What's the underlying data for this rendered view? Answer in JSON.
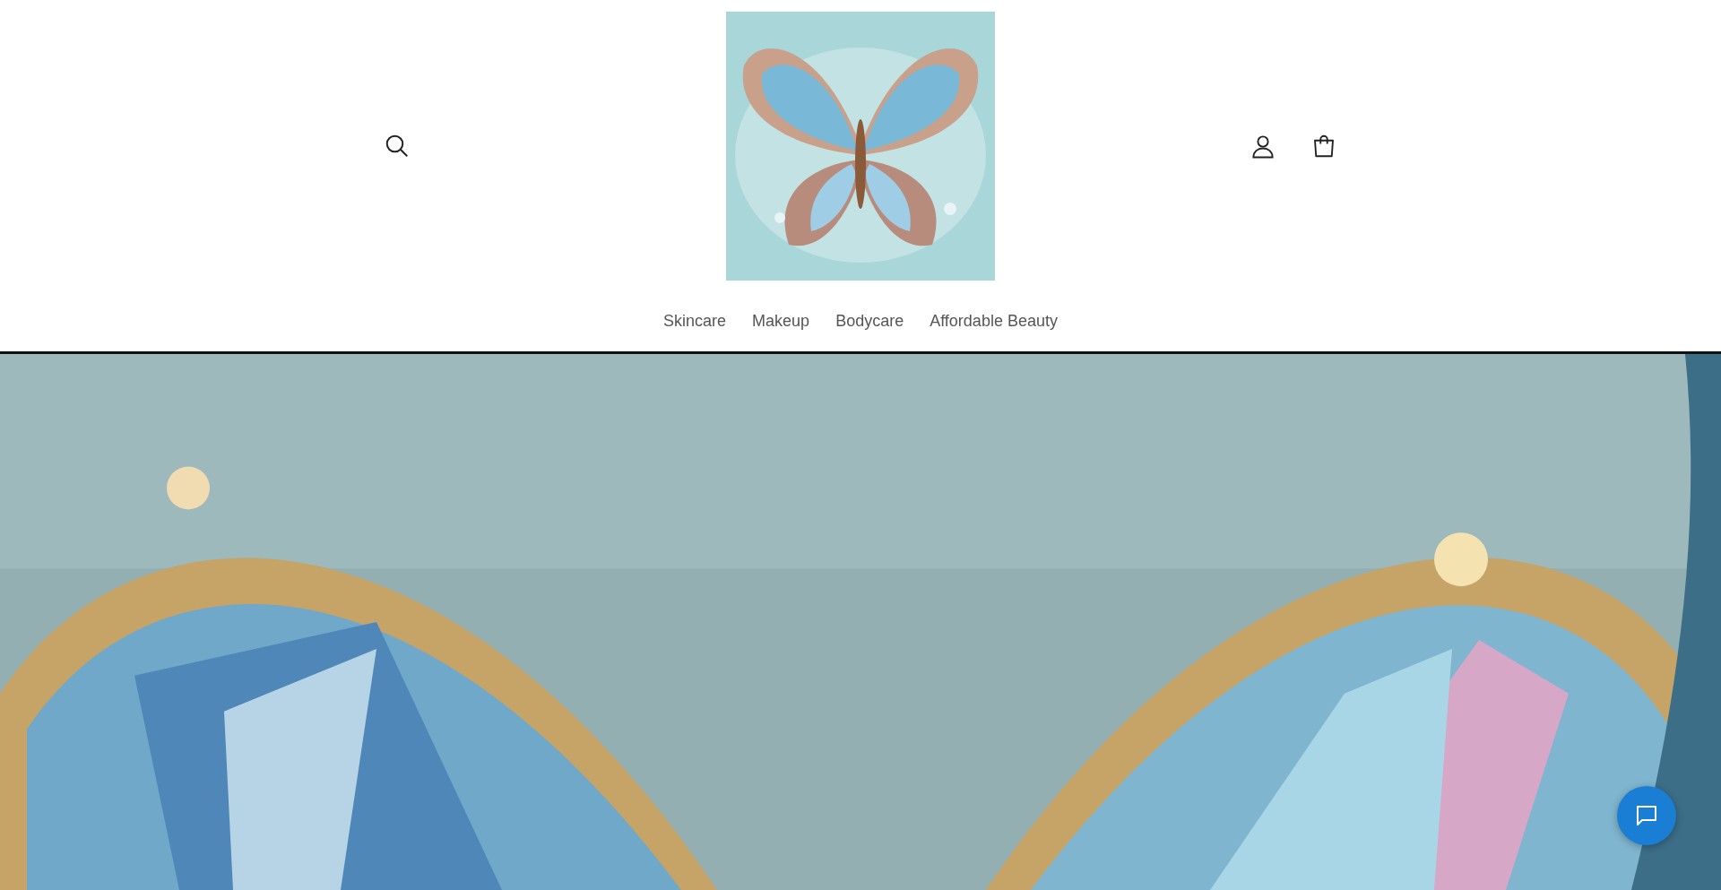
{
  "nav": [
    {
      "label": "Skincare"
    },
    {
      "label": "Makeup"
    },
    {
      "label": "Bodycare"
    },
    {
      "label": "Affordable Beauty"
    }
  ]
}
